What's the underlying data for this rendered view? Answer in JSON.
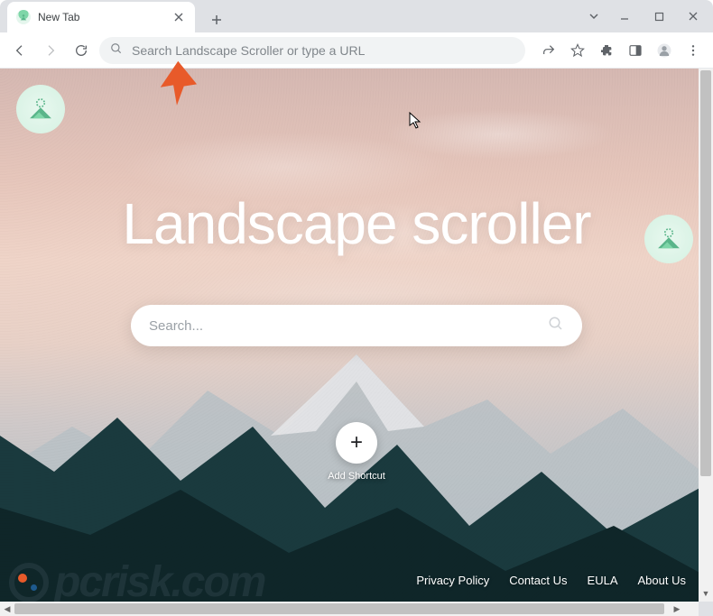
{
  "browser": {
    "tab": {
      "title": "New Tab"
    },
    "omnibox": {
      "placeholder": "Search Landscape Scroller or type a URL"
    }
  },
  "page": {
    "headline": "Landscape scroller",
    "search": {
      "placeholder": "Search..."
    },
    "shortcut": {
      "add_label": "Add Shortcut",
      "plus": "+"
    },
    "footer": {
      "links": [
        {
          "label": "Privacy Policy"
        },
        {
          "label": "Contact Us"
        },
        {
          "label": "EULA"
        },
        {
          "label": "About Us"
        }
      ]
    }
  },
  "watermark": {
    "text": "pcrisk.com"
  },
  "icons": {
    "close": "✕",
    "plus": "+"
  },
  "colors": {
    "accent_green": "#7ed6a8",
    "arrow": "#e85a2a",
    "sky_top": "#d5b8b2",
    "sky_bottom": "#a9bcc4"
  }
}
